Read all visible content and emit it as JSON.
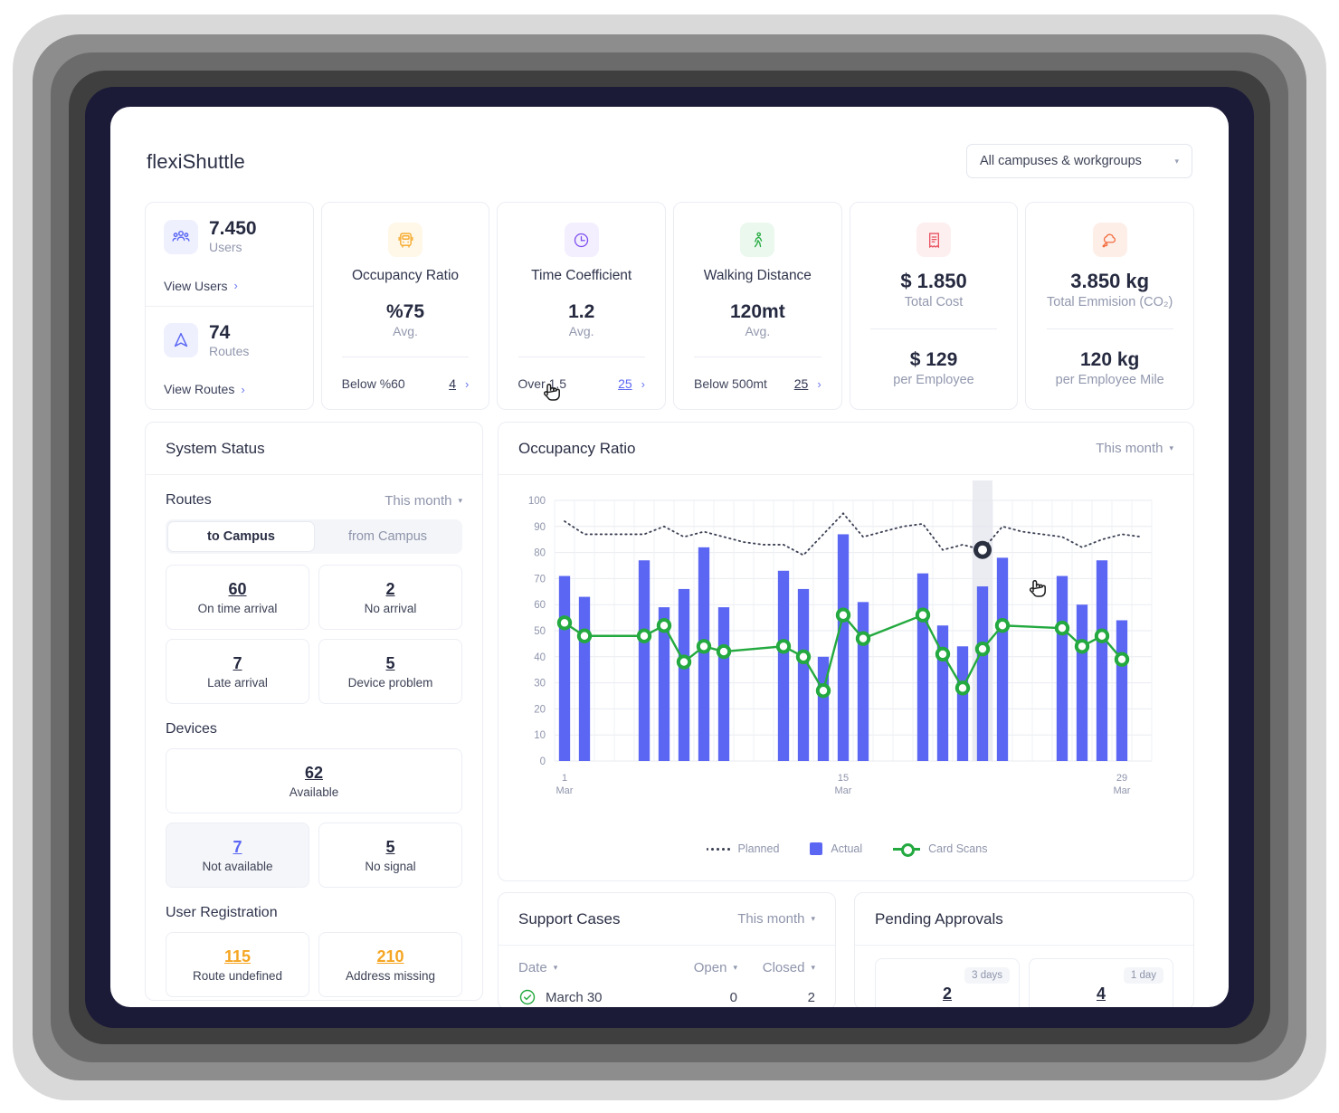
{
  "header": {
    "title": "flexiShuttle",
    "campus_select": {
      "value": "All campuses & workgroups",
      "caret": "▾"
    }
  },
  "kpi": {
    "users": {
      "icon": "users-icon",
      "value": "7.450",
      "label": "Users",
      "link": "View Users",
      "chevron": "›"
    },
    "routes": {
      "icon": "navigation-arrow-icon",
      "value": "74",
      "label": "Routes",
      "link": "View Routes",
      "chevron": "›"
    },
    "occupancy": {
      "icon": "bus-icon",
      "title": "Occupancy Ratio",
      "value": "%75",
      "sub": "Avg.",
      "foot_label": "Below %60",
      "foot_count": "4",
      "chevron": "›"
    },
    "time_coefficient": {
      "icon": "clock-icon",
      "title": "Time Coefficient",
      "value": "1.2",
      "sub": "Avg.",
      "foot_label": "Over 1.5",
      "foot_count": "25",
      "chevron": "›"
    },
    "walking_distance": {
      "icon": "walking-person-icon",
      "title": "Walking Distance",
      "value": "120mt",
      "sub": "Avg.",
      "foot_label": "Below 500mt",
      "foot_count": "25",
      "chevron": "›"
    },
    "total_cost": {
      "icon": "receipt-icon",
      "value": "$ 1.850",
      "label": "Total Cost",
      "value2": "$ 129",
      "label2": "per Employee"
    },
    "total_emission": {
      "icon": "cloud-emission-icon",
      "value": "3.850 kg",
      "label": "Total Emmision (CO₂)",
      "value2": "120 kg",
      "label2": "per Employee Mile"
    }
  },
  "system_status": {
    "title": "System Status",
    "routes": {
      "section": "Routes",
      "period": "This month",
      "caret": "▾",
      "toggle": [
        {
          "label": "to Campus",
          "active": true
        },
        {
          "label": "from Campus",
          "active": false
        }
      ],
      "stats": [
        {
          "num": "60",
          "label": "On time arrival"
        },
        {
          "num": "2",
          "label": "No arrival"
        },
        {
          "num": "7",
          "label": "Late arrival"
        },
        {
          "num": "5",
          "label": "Device problem"
        }
      ]
    },
    "devices": {
      "section": "Devices",
      "stats": [
        {
          "num": "62",
          "label": "Available",
          "full": true
        },
        {
          "num": "7",
          "label": "Not available",
          "shaded": true,
          "accent": "blue"
        },
        {
          "num": "5",
          "label": "No signal"
        }
      ]
    },
    "user_registration": {
      "section": "User Registration",
      "stats": [
        {
          "num": "115",
          "label": "Route undefined",
          "accent": "amber"
        },
        {
          "num": "210",
          "label": "Address missing",
          "accent": "amber"
        }
      ]
    }
  },
  "occupancy_panel": {
    "title": "Occupancy Ratio",
    "period": "This month",
    "caret": "▾"
  },
  "support_cases": {
    "title": "Support Cases",
    "period": "This month",
    "caret": "▾",
    "columns": [
      "Date",
      "Open",
      "Closed"
    ],
    "rows": [
      {
        "status_icon": "check-circle-icon",
        "date": "March 30",
        "open": "0",
        "closed": "2"
      }
    ]
  },
  "pending_approvals": {
    "title": "Pending Approvals",
    "items": [
      {
        "badge": "3 days",
        "num": "2"
      },
      {
        "badge": "1 day",
        "num": "4"
      }
    ]
  },
  "colors": {
    "bar": "#5b67f3",
    "line": "#23a93f",
    "planned": "#3a3f52",
    "accent_amber": "#f5a623",
    "accent_red": "#e8515f",
    "accent_orange": "#f36c3d",
    "text_dark": "#262a40",
    "text_muted": "#8e94ab"
  },
  "chart_data": {
    "type": "bar",
    "title": "Occupancy Ratio",
    "xlabel": "",
    "ylabel": "",
    "ylim": [
      0,
      100
    ],
    "yticks": [
      0,
      10,
      20,
      30,
      40,
      50,
      60,
      70,
      80,
      90,
      100
    ],
    "grid": true,
    "legend_position": "bottom",
    "xtick_labels": [
      {
        "index": 0,
        "line1": "1",
        "line2": "Mar"
      },
      {
        "index": 14,
        "line1": "15",
        "line2": "Mar"
      },
      {
        "index": 28,
        "line1": "29",
        "line2": "Mar"
      }
    ],
    "x": [
      1,
      2,
      3,
      4,
      5,
      6,
      7,
      8,
      9,
      10,
      11,
      12,
      13,
      14,
      15,
      16,
      17,
      18,
      19,
      20,
      21,
      22,
      23,
      24,
      25,
      26,
      27,
      28,
      29,
      30
    ],
    "highlight_index": 21,
    "series": [
      {
        "name": "Planned",
        "type": "line",
        "style": "dotted",
        "color": "#3a3f52",
        "values": [
          92,
          87,
          87,
          87,
          87,
          90,
          86,
          88,
          86,
          84,
          83,
          83,
          79,
          87,
          95,
          86,
          88,
          90,
          91,
          81,
          83,
          81,
          90,
          88,
          87,
          86,
          82,
          85,
          87,
          86
        ]
      },
      {
        "name": "Actual",
        "type": "bar",
        "color": "#5b67f3",
        "values": [
          71,
          63,
          null,
          null,
          77,
          59,
          66,
          82,
          59,
          null,
          null,
          73,
          66,
          40,
          87,
          61,
          null,
          null,
          72,
          52,
          44,
          67,
          78,
          null,
          null,
          71,
          60,
          77,
          54,
          null
        ]
      },
      {
        "name": "Card Scans",
        "type": "line",
        "color": "#23a93f",
        "markers": true,
        "values": [
          53,
          48,
          null,
          null,
          48,
          52,
          38,
          44,
          42,
          null,
          null,
          44,
          40,
          27,
          56,
          47,
          null,
          null,
          56,
          41,
          28,
          43,
          52,
          null,
          null,
          51,
          44,
          48,
          39,
          null
        ]
      }
    ]
  }
}
